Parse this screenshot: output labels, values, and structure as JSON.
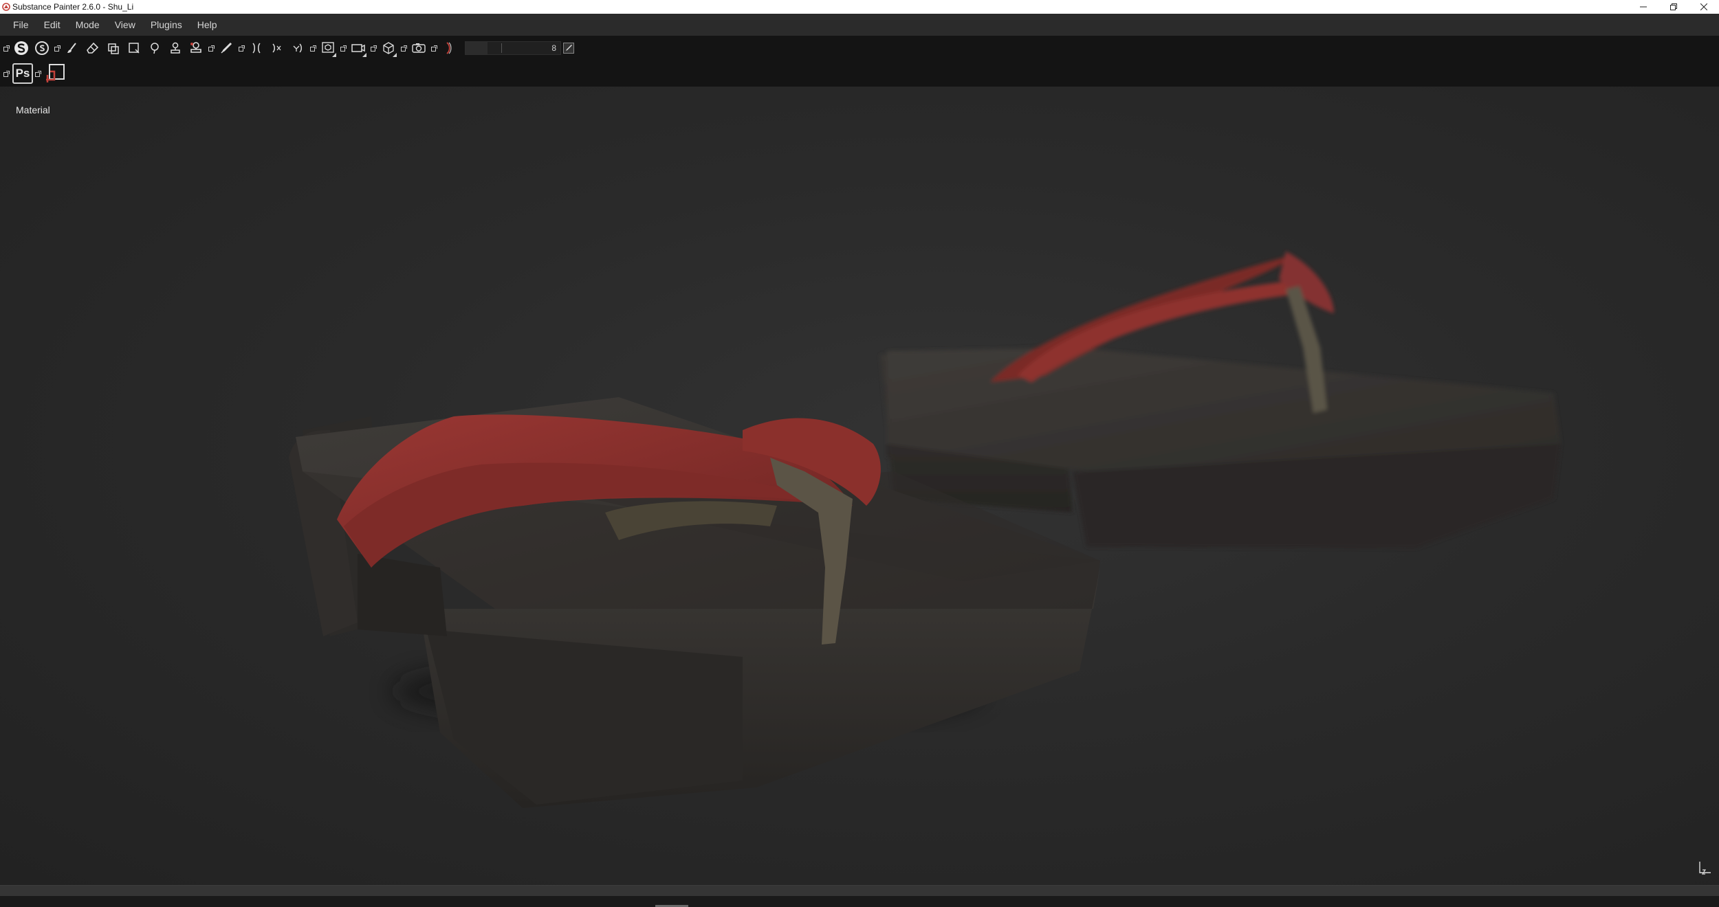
{
  "window": {
    "title": "Substance Painter 2.6.0 - Shu_Li",
    "icon": "substance-painter-logo-icon",
    "controls": [
      "minimize-icon",
      "restore-icon",
      "close-icon"
    ]
  },
  "menu": {
    "items": [
      {
        "label": "File"
      },
      {
        "label": "Edit"
      },
      {
        "label": "Mode"
      },
      {
        "label": "View"
      },
      {
        "label": "Plugins"
      },
      {
        "label": "Help"
      }
    ]
  },
  "toolbar": {
    "tools": [
      "paint-icon",
      "eraser-icon",
      "projection-icon",
      "polygon-fill-icon",
      "smudge-icon",
      "clone-icon",
      "material-picker-icon",
      "pipette-icon",
      "symmetry-icon",
      "camera-icon",
      "screenshot-icon"
    ],
    "brush_size_value": "8",
    "brush_size_fill_fraction": 0.23
  },
  "toolbar2": {
    "photoshop_label": "Ps"
  },
  "viewport": {
    "mode_label": "Material"
  },
  "colors": {
    "accent_red": "#c2413a",
    "strap_red": "#8a2f2c",
    "wood": "#3d3a37"
  }
}
